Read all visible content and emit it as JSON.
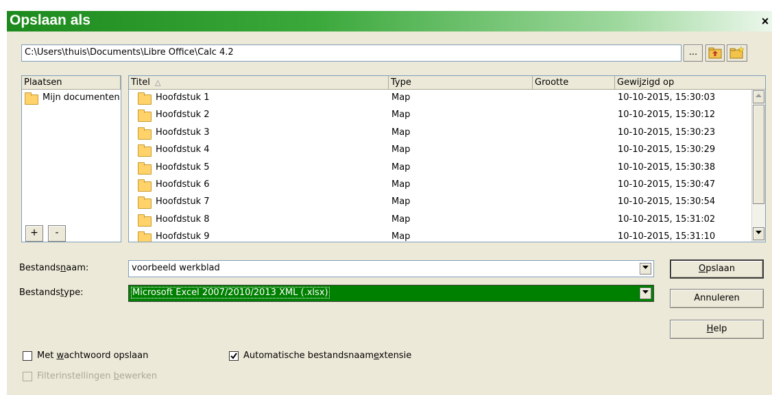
{
  "window": {
    "title": "Opslaan als",
    "close_symbol": "×"
  },
  "path": {
    "value": "C:\\Users\\thuis\\Documents\\Libre Office\\Calc 4.2"
  },
  "toolbar": {
    "browse_label": "...",
    "up_icon": "folder-up-icon",
    "new_folder_icon": "new-folder-icon"
  },
  "places": {
    "header": "Plaatsen",
    "items": [
      {
        "label": "Mijn documenten"
      }
    ],
    "add_label": "+",
    "remove_label": "-"
  },
  "files": {
    "columns": {
      "title": "Titel",
      "sort_indicator": "△",
      "type": "Type",
      "size": "Grootte",
      "modified": "Gewijzigd op"
    },
    "rows": [
      {
        "name": "Hoofdstuk 1",
        "type": "Map",
        "size": "",
        "modified": "10-10-2015, 15:30:03"
      },
      {
        "name": "Hoofdstuk 2",
        "type": "Map",
        "size": "",
        "modified": "10-10-2015, 15:30:12"
      },
      {
        "name": "Hoofdstuk 3",
        "type": "Map",
        "size": "",
        "modified": "10-10-2015, 15:30:23"
      },
      {
        "name": "Hoofdstuk 4",
        "type": "Map",
        "size": "",
        "modified": "10-10-2015, 15:30:29"
      },
      {
        "name": "Hoofdstuk 5",
        "type": "Map",
        "size": "",
        "modified": "10-10-2015, 15:30:38"
      },
      {
        "name": "Hoofdstuk 6",
        "type": "Map",
        "size": "",
        "modified": "10-10-2015, 15:30:47"
      },
      {
        "name": "Hoofdstuk 7",
        "type": "Map",
        "size": "",
        "modified": "10-10-2015, 15:30:54"
      },
      {
        "name": "Hoofdstuk 8",
        "type": "Map",
        "size": "",
        "modified": "10-10-2015, 15:31:02"
      },
      {
        "name": "Hoofdstuk 9",
        "type": "Map",
        "size": "",
        "modified": "10-10-2015, 15:31:10"
      }
    ]
  },
  "filename": {
    "label_pre": "Bestands",
    "label_accel": "n",
    "label_post": "aam:",
    "value": "voorbeeld werkblad"
  },
  "filetype": {
    "label_pre": "Bestands",
    "label_accel": "t",
    "label_post": "ype:",
    "value": "Microsoft Excel 2007/2010/2013 XML (.xlsx)"
  },
  "buttons": {
    "save": {
      "accel": "O",
      "rest": "pslaan"
    },
    "cancel": {
      "label": "Annuleren"
    },
    "help": {
      "accel": "H",
      "rest": "elp"
    }
  },
  "options": {
    "password": {
      "pre": "Met ",
      "accel": "w",
      "post": "achtwoord opslaan",
      "checked": false
    },
    "auto_ext": {
      "pre": "Automatische bestandsnaam",
      "accel": "e",
      "post": "xtensie",
      "checked": true
    },
    "filter": {
      "pre": "Filterinstellingen ",
      "accel": "b",
      "post": "ewerken",
      "checked": false,
      "enabled": false
    }
  },
  "colors": {
    "title_gradient_start": "#1d8a1d",
    "filetype_selected_bg": "#008000",
    "dialog_bg": "#ece9d8"
  }
}
